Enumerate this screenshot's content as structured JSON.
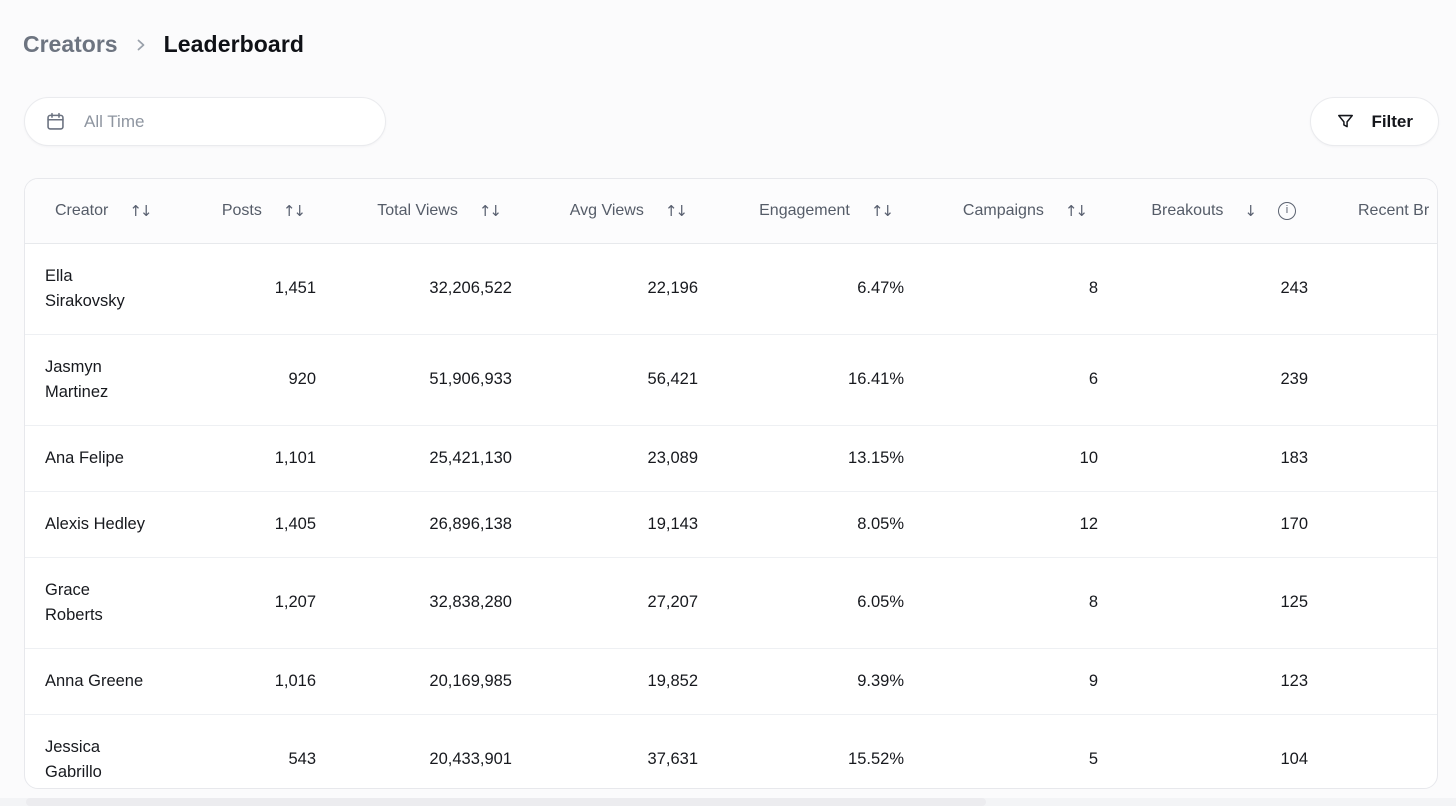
{
  "breadcrumb": {
    "parent": "Creators",
    "current": "Leaderboard"
  },
  "toolbar": {
    "date_range_placeholder": "All Time",
    "filter_label": "Filter"
  },
  "table": {
    "columns": [
      {
        "key": "creator",
        "label": "Creator",
        "align": "left",
        "sort": "updown",
        "info": false
      },
      {
        "key": "posts",
        "label": "Posts",
        "align": "right",
        "sort": "updown",
        "info": false
      },
      {
        "key": "total_views",
        "label": "Total Views",
        "align": "right",
        "sort": "updown",
        "info": false
      },
      {
        "key": "avg_views",
        "label": "Avg Views",
        "align": "right",
        "sort": "updown",
        "info": false
      },
      {
        "key": "engagement",
        "label": "Engagement",
        "align": "right",
        "sort": "updown",
        "info": false
      },
      {
        "key": "campaigns",
        "label": "Campaigns",
        "align": "right",
        "sort": "updown",
        "info": false
      },
      {
        "key": "breakouts",
        "label": "Breakouts",
        "align": "right",
        "sort": "desc",
        "info": true
      },
      {
        "key": "recent_breakouts",
        "label": "Recent Br",
        "align": "last",
        "sort": null,
        "info": false
      }
    ],
    "rows": [
      {
        "creator": "Ella Sirakovsky",
        "posts": "1,451",
        "total_views": "32,206,522",
        "avg_views": "22,196",
        "engagement": "6.47%",
        "campaigns": "8",
        "breakouts": "243",
        "recent_breakouts": ""
      },
      {
        "creator": "Jasmyn Martinez",
        "posts": "920",
        "total_views": "51,906,933",
        "avg_views": "56,421",
        "engagement": "16.41%",
        "campaigns": "6",
        "breakouts": "239",
        "recent_breakouts": ""
      },
      {
        "creator": "Ana Felipe",
        "posts": "1,101",
        "total_views": "25,421,130",
        "avg_views": "23,089",
        "engagement": "13.15%",
        "campaigns": "10",
        "breakouts": "183",
        "recent_breakouts": ""
      },
      {
        "creator": "Alexis Hedley",
        "posts": "1,405",
        "total_views": "26,896,138",
        "avg_views": "19,143",
        "engagement": "8.05%",
        "campaigns": "12",
        "breakouts": "170",
        "recent_breakouts": ""
      },
      {
        "creator": "Grace Roberts",
        "posts": "1,207",
        "total_views": "32,838,280",
        "avg_views": "27,207",
        "engagement": "6.05%",
        "campaigns": "8",
        "breakouts": "125",
        "recent_breakouts": ""
      },
      {
        "creator": "Anna Greene",
        "posts": "1,016",
        "total_views": "20,169,985",
        "avg_views": "19,852",
        "engagement": "9.39%",
        "campaigns": "9",
        "breakouts": "123",
        "recent_breakouts": ""
      },
      {
        "creator": "Jessica Gabrillo",
        "posts": "543",
        "total_views": "20,433,901",
        "avg_views": "37,631",
        "engagement": "15.52%",
        "campaigns": "5",
        "breakouts": "104",
        "recent_breakouts": ""
      }
    ]
  },
  "icons": {
    "sort_both": "↑↓",
    "sort_desc": "↓",
    "info": "i"
  },
  "colors": {
    "page_bg": "#fbfbfc",
    "card_bg": "#ffffff",
    "border": "#e7e8ec",
    "row_border": "#eef0f3",
    "header_text": "#555c68",
    "cell_text": "#17191e",
    "muted_text": "#6d7480",
    "placeholder_text": "#8e95a0"
  }
}
